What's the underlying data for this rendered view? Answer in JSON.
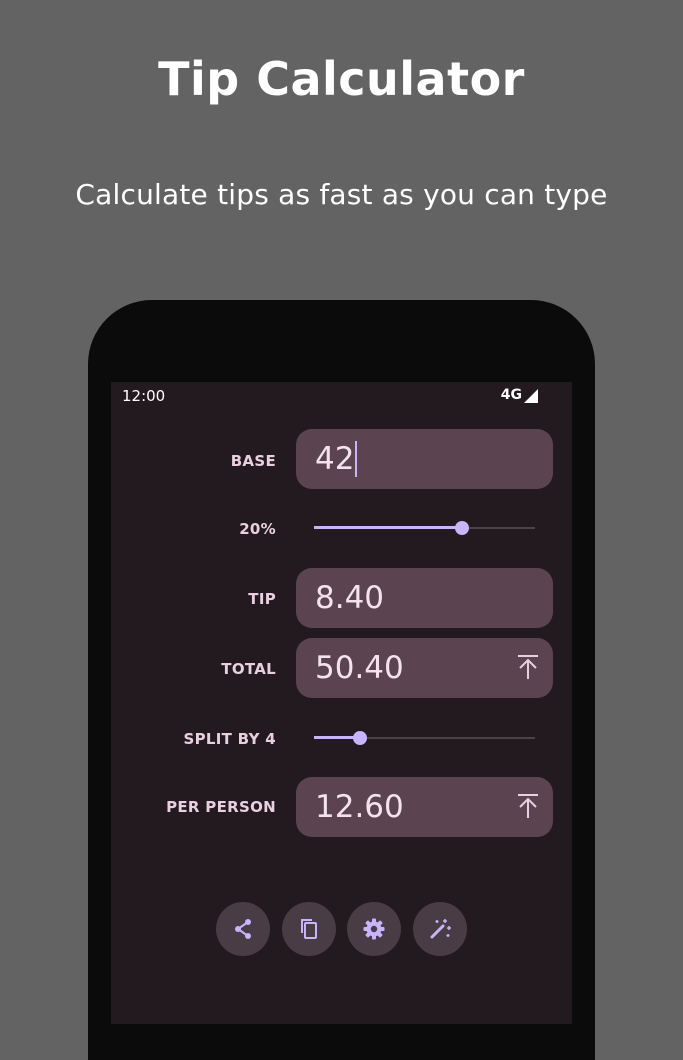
{
  "promo": {
    "title": "Tip Calculator",
    "subtitle": "Calculate tips as fast as you can type"
  },
  "status_bar": {
    "time": "12:00",
    "network": "4G"
  },
  "calculator": {
    "base": {
      "label": "BASE",
      "value": "42"
    },
    "tip_percent": {
      "label": "20%",
      "slider_fraction": 0.67
    },
    "tip": {
      "label": "TIP",
      "value": "8.40"
    },
    "total": {
      "label": "TOTAL",
      "value": "50.40"
    },
    "split": {
      "label": "SPLIT BY 4",
      "slider_fraction": 0.21
    },
    "per_person": {
      "label": "PER PERSON",
      "value": "12.60"
    }
  },
  "actions": [
    "share-icon",
    "copy-icon",
    "settings-icon",
    "magic-wand-icon"
  ],
  "colors": {
    "background": "#636363",
    "screen": "#231a20",
    "field": "#5b4450",
    "accent": "#c8b3ff"
  }
}
